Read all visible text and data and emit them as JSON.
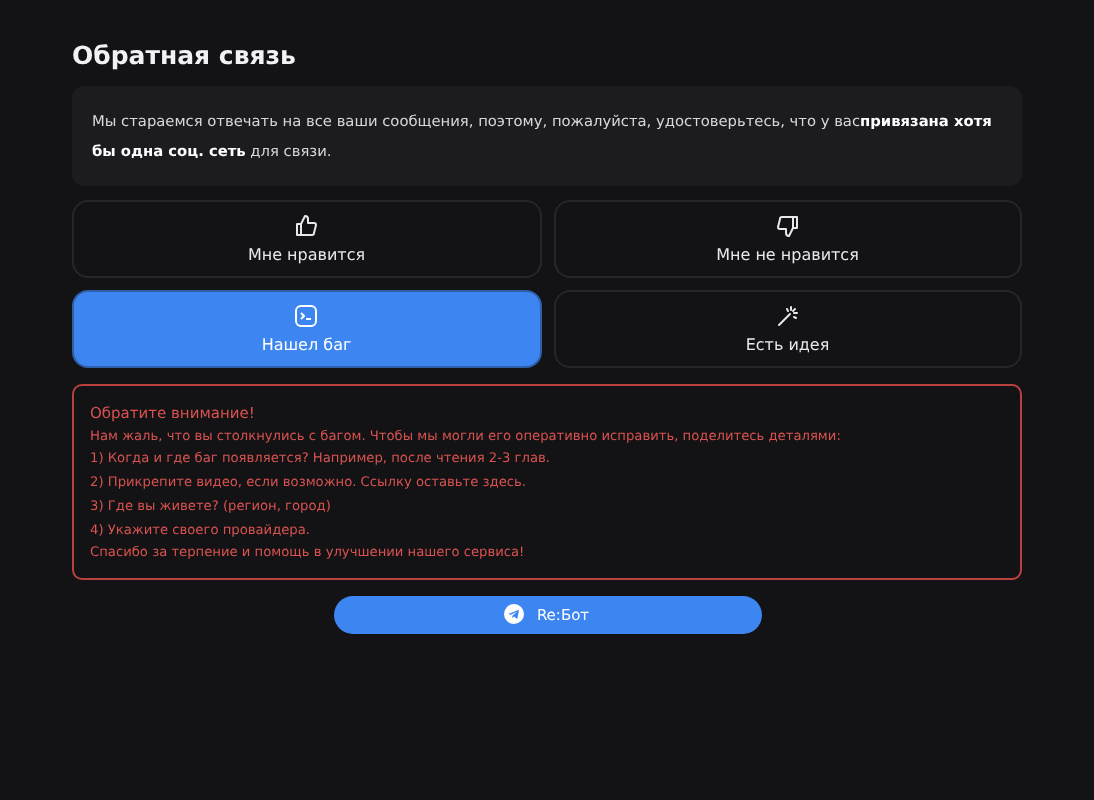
{
  "title": "Обратная связь",
  "notice": "Мы стараемся отвечать на все ваши сообщения, поэтому, пожалуйста, удостоверьтесь, что у вас**привязана хотя бы одна соц. сеть** для связи.",
  "options": [
    {
      "kind": "like",
      "label": "Мне нравится",
      "selected": false
    },
    {
      "kind": "dislike",
      "label": "Мне не нравится",
      "selected": false
    },
    {
      "kind": "bug",
      "label": "Нашел баг",
      "selected": true
    },
    {
      "kind": "idea",
      "label": "Есть идея",
      "selected": false
    }
  ],
  "alert": {
    "heading": "Обратите внимание!",
    "lines": [
      "Нам жаль, что вы столкнулись с багом. Чтобы мы могли его оперативно исправить, поделитесь деталями:",
      "1) Когда и где баг появляется? Например, после чтения 2-3 глав.",
      "2) Прикрепите видео, если возможно. Ссылку оставьте здесь.",
      "3) Где вы живете? (регион, город)",
      "4) Укажите своего провайдера.",
      "Спасибо за терпение и помощь в улучшении нашего сервиса!"
    ]
  },
  "button": {
    "label": "Re:Бот"
  }
}
